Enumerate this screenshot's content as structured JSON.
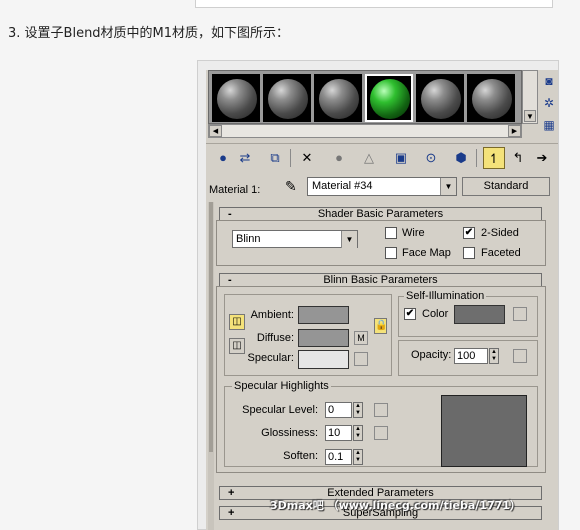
{
  "article": {
    "step_text": "3. 设置子Blend材质中的M1材质，如下图所示："
  },
  "slots": {
    "count": 6,
    "active_index": 3,
    "active_color": "#2fbf2f"
  },
  "side_icons": [
    "sample-type-icon",
    "backlight-icon",
    "background-icon"
  ],
  "toolbar": {
    "icons": [
      "get-material-icon",
      "put-to-scene-icon",
      "assign-to-selection-icon",
      "reset-map-icon",
      "make-unique-icon",
      "put-to-library-icon",
      "material-id-icon",
      "show-map-icon",
      "show-end-result-icon",
      "go-to-parent-icon",
      "go-forward-icon"
    ]
  },
  "material": {
    "label": "Material 1:",
    "name": "Material #34",
    "type_button": "Standard"
  },
  "shader_basic": {
    "title": "Shader Basic Parameters",
    "sign": "-",
    "shader": "Blinn",
    "wire_label": "Wire",
    "wire_checked": false,
    "two_sided_label": "2-Sided",
    "two_sided_checked": true,
    "facemap_label": "Face Map",
    "facemap_checked": false,
    "faceted_label": "Faceted",
    "faceted_checked": false,
    "check_mark": "✔"
  },
  "blinn_basic": {
    "title": "Blinn Basic Parameters",
    "sign": "-",
    "ambient_label": "Ambient:",
    "diffuse_label": "Diffuse:",
    "specular_label": "Specular:",
    "ambient_color": "#959595",
    "diffuse_color": "#959595",
    "specular_color": "#e6e6e6",
    "map_button": "M",
    "self_illum_title": "Self-Illumination",
    "self_illum_color_label": "Color",
    "self_illum_color_checked": true,
    "self_illum_color": "#6e6e6e",
    "opacity_label": "Opacity:",
    "opacity_value": "100"
  },
  "specular_highlights": {
    "title": "Specular Highlights",
    "level_label": "Specular Level:",
    "level_value": "0",
    "gloss_label": "Glossiness:",
    "gloss_value": "10",
    "soften_label": "Soften:",
    "soften_value": "0.1",
    "curve_color": "#6a6a6a"
  },
  "collapsed_rollouts": [
    {
      "sign": "+",
      "title": "Extended Parameters"
    },
    {
      "sign": "+",
      "title": "SuperSampling"
    }
  ],
  "watermark": "3Dmax吧 （www.linecg.com/tieba/1771）"
}
